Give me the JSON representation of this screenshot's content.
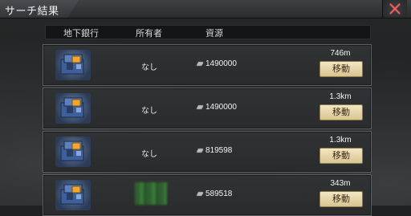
{
  "window": {
    "title": "サーチ結果"
  },
  "columns": {
    "bank": "地下銀行",
    "owner": "所有者",
    "resource": "資源"
  },
  "results": [
    {
      "owner": "なし",
      "resource": "1490000",
      "distance": "746m",
      "action": "移動"
    },
    {
      "owner": "なし",
      "resource": "1490000",
      "distance": "1.3km",
      "action": "移動"
    },
    {
      "owner": "なし",
      "resource": "819598",
      "distance": "1.3km",
      "action": "移動"
    },
    {
      "owner": "",
      "owner_obscured": true,
      "resource": "589518",
      "distance": "343m",
      "action": "移動"
    }
  ],
  "icons": {
    "close": "close-x-icon",
    "bank": "bank-vault-icon",
    "resource": "silver-ingot-icon"
  },
  "colors": {
    "button_bg": "#e8d7a8",
    "close_x": "#c94848",
    "card_border": "#5d6062"
  }
}
